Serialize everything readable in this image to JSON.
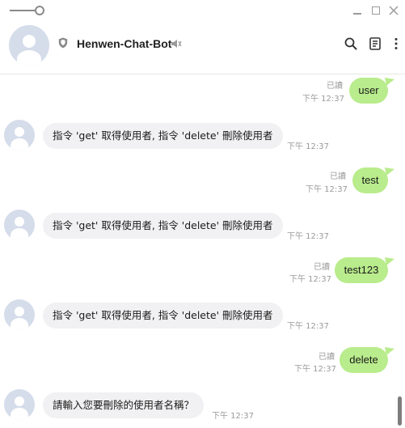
{
  "window": {
    "controls": {
      "minimize": "minimize-icon",
      "maximize": "maximize-icon",
      "close": "close-icon"
    }
  },
  "header": {
    "title": "Henwen-Chat-Bot",
    "icons": [
      "shield-icon",
      "mute-icon",
      "search-icon",
      "notes-icon",
      "more-icon"
    ]
  },
  "messages": [
    {
      "direction": "out",
      "text": "user",
      "read": "已讀",
      "time": "下午 12:37"
    },
    {
      "direction": "in",
      "text": "指令 'get' 取得使用者, 指令 'delete' 刪除使用者",
      "time": "下午 12:37"
    },
    {
      "direction": "out",
      "text": "test",
      "read": "已讀",
      "time": "下午 12:37"
    },
    {
      "direction": "in",
      "text": "指令 'get' 取得使用者, 指令 'delete' 刪除使用者",
      "time": "下午 12:37"
    },
    {
      "direction": "out",
      "text": "test123",
      "read": "已讀",
      "time": "下午 12:37"
    },
    {
      "direction": "in",
      "text": "指令 'get' 取得使用者, 指令 'delete' 刪除使用者",
      "time": "下午 12:37"
    },
    {
      "direction": "out",
      "text": "delete",
      "read": "已讀",
      "time": "下午 12:37"
    },
    {
      "direction": "in",
      "text": "請輸入您要刪除的使用者名稱？",
      "time": "下午 12:37"
    }
  ],
  "colors": {
    "outgoing_bubble": "#b9ec8c",
    "incoming_bubble": "#f1f1f3",
    "avatar": "#d5dcea"
  }
}
